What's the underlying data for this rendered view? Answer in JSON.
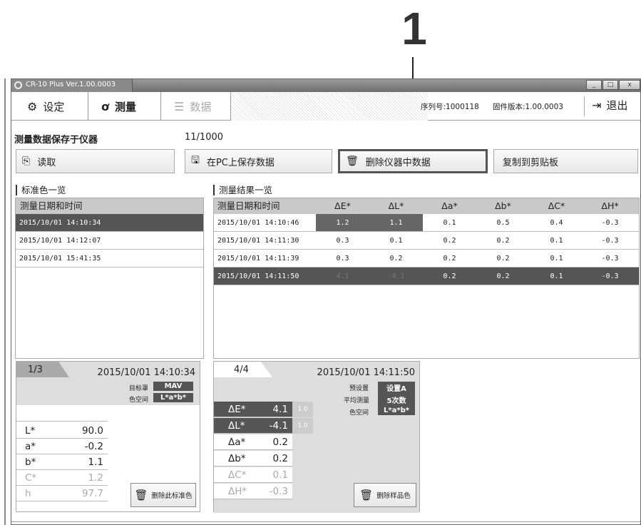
{
  "callout": {
    "number": "1"
  },
  "window": {
    "title": "CR-10 Plus Ver.1.00.0003",
    "buttons": [
      "_",
      "□",
      "x"
    ]
  },
  "tabs": [
    {
      "label": "设定",
      "icon": "gear-icon"
    },
    {
      "label": "测量",
      "icon": "measure-icon"
    },
    {
      "label": "数据",
      "icon": "list-icon"
    }
  ],
  "header": {
    "serial": "序列号:1000118",
    "firmware": "固件版本:1.00.0003",
    "exit_label": "退出"
  },
  "storage": {
    "label": "测量数据保存于仪器",
    "count": "11/1000"
  },
  "toolbar": {
    "read_label": "读取",
    "save_pc_label": "在PC上保存数据",
    "delete_label": "删除仪器中数据",
    "copy_label": "复制到剪贴板"
  },
  "standards": {
    "title": "标准色一览",
    "column": "测量日期和时间",
    "rows": [
      "2015/10/01 14:10:34",
      "2015/10/01 14:12:07",
      "2015/10/01 15:41:35"
    ]
  },
  "results": {
    "title": "测量结果一览",
    "columns": [
      "测量日期和时间",
      "ΔE*",
      "ΔL*",
      "Δa*",
      "Δb*",
      "ΔC*",
      "ΔH*"
    ],
    "rows": [
      [
        "2015/10/01 14:10:46",
        "1.2",
        "1.1",
        "0.1",
        "0.5",
        "0.4",
        "-0.3"
      ],
      [
        "2015/10/01 14:11:30",
        "0.3",
        "0.1",
        "0.2",
        "0.2",
        "0.1",
        "-0.3"
      ],
      [
        "2015/10/01 14:11:39",
        "0.3",
        "0.2",
        "0.2",
        "0.2",
        "0.1",
        "-0.3"
      ],
      [
        "2015/10/01 14:11:50",
        "4.1",
        "-4.1",
        "0.2",
        "0.2",
        "0.1",
        "-0.3"
      ]
    ]
  },
  "standard_card": {
    "index": "1/3",
    "datetime": "2015/10/01 14:10:34",
    "target_label": "目标罩",
    "target_value": "MAV",
    "space_label": "色空间",
    "space_value": "L*a*b*",
    "values": [
      {
        "name": "L*",
        "value": "90.0"
      },
      {
        "name": "a*",
        "value": "-0.2"
      },
      {
        "name": "b*",
        "value": "1.1"
      },
      {
        "name": "C*",
        "value": "1.2"
      },
      {
        "name": "h",
        "value": "97.7"
      }
    ],
    "delete_label": "删除此标准色"
  },
  "sample_card": {
    "index": "4/4",
    "datetime": "2015/10/01 14:11:50",
    "preset_label": "预设置",
    "preset_value": "设置A",
    "avg_label": "平均测量",
    "avg_value": "5次数",
    "space_label": "色空间",
    "space_value": "L*a*b*",
    "values": [
      {
        "name": "ΔE*",
        "value": "4.1",
        "tol": "1.0"
      },
      {
        "name": "ΔL*",
        "value": "-4.1",
        "tol": "1.0"
      },
      {
        "name": "Δa*",
        "value": "0.2",
        "tol": ""
      },
      {
        "name": "Δb*",
        "value": "0.2",
        "tol": ""
      },
      {
        "name": "ΔC*",
        "value": "0.1",
        "tol": ""
      },
      {
        "name": "ΔH*",
        "value": "-0.3",
        "tol": ""
      }
    ],
    "delete_label": "删除样品色"
  }
}
